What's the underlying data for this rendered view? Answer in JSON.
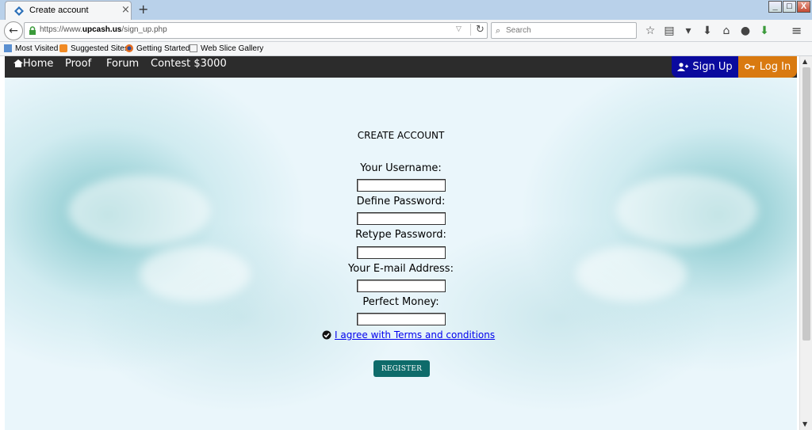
{
  "browser": {
    "tab_title": "Create account",
    "tab_close": "×",
    "new_tab": "+",
    "url_prefix": "https://www.",
    "url_domain": "upcash.us",
    "url_path": "/sign_up.php",
    "search_placeholder": "Search",
    "bookmarks": [
      "Most Visited",
      "Suggested Sites",
      "Getting Started",
      "Web Slice Gallery"
    ],
    "window_controls": [
      "_",
      "□",
      "X"
    ]
  },
  "site_nav": {
    "home": "Home",
    "proof": "Proof",
    "forum": "Forum",
    "contest": "Contest $3000",
    "signup": "Sign Up",
    "login": "Log In"
  },
  "form": {
    "title": "CREATE ACCOUNT",
    "username_label": "Your Username:",
    "password_label": "Define Password:",
    "retype_label": "Retype Password:",
    "email_label": "Your E-mail Address:",
    "perfect_money_label": "Perfect Money:",
    "terms_link": "I agree with Terms and conditions",
    "register_button": "REGISTER"
  },
  "colors": {
    "nav_bg": "#2c2c2c",
    "signup_bg": "#0a0a9e",
    "login_bg": "#d97a10",
    "register_bg": "#0e6b6a",
    "link": "#0000ee"
  }
}
